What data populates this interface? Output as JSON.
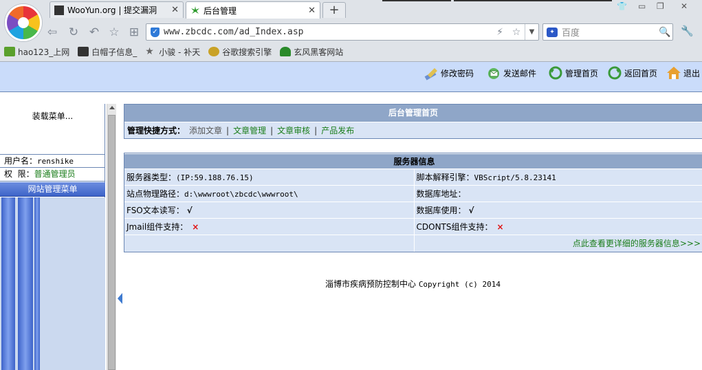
{
  "browser": {
    "tabs": [
      {
        "title": "WooYun.org | 提交漏洞",
        "active": false
      },
      {
        "title": "后台管理",
        "active": true
      }
    ],
    "url": "www.zbcdc.com/ad_Index.asp",
    "search_placeholder": "百度",
    "bookmarks": [
      "hao123_上网",
      "白帽子信息_",
      "小骏 - 补天",
      "谷歌搜索引擎",
      "玄风黑客网站"
    ]
  },
  "topnav": {
    "items": [
      "修改密码",
      "发送邮件",
      "管理首页",
      "返回首页",
      "退出"
    ]
  },
  "sidebar": {
    "loading_text": "装载菜单...",
    "username_label": "用户名：",
    "username": "renshike",
    "role_label": "权  限：",
    "role": "普通管理员",
    "menu_header": "网站管理菜单"
  },
  "main": {
    "title": "后台管理首页",
    "quick_label": "管理快捷方式：",
    "quick_links": [
      "添加文章",
      "文章管理",
      "文章审核",
      "产品发布"
    ],
    "server_title": "服务器信息",
    "server_type_label": "服务器类型：",
    "server_type_value": "(IP:59.188.76.15)",
    "script_engine_label": "脚本解释引擎：",
    "script_engine_value": "VBScript/5.8.23141",
    "physical_path_label": "站点物理路径：",
    "physical_path_value": "d:\\wwwroot\\zbcdc\\wwwroot\\",
    "db_addr_label": "数据库地址：",
    "fso_label": "FSO文本读写：",
    "fso_value": "√",
    "db_use_label": "数据库使用：",
    "db_use_value": "√",
    "jmail_label": "Jmail组件支持：",
    "jmail_value": "×",
    "cdonts_label": "CDONTS组件支持：",
    "cdonts_value": "×",
    "more_link": "点此查看更详细的服务器信息>>>"
  },
  "footer": {
    "org": "淄博市疾病预防控制中心",
    "copyright": "Copyright (c) 2014"
  },
  "colors": {
    "header_bg": "#cadcfa",
    "panel_title_bg": "#8fa6c8",
    "row_bg": "#d9e4f5",
    "link_green": "#1a7d1a",
    "cross_red": "#e01010"
  }
}
